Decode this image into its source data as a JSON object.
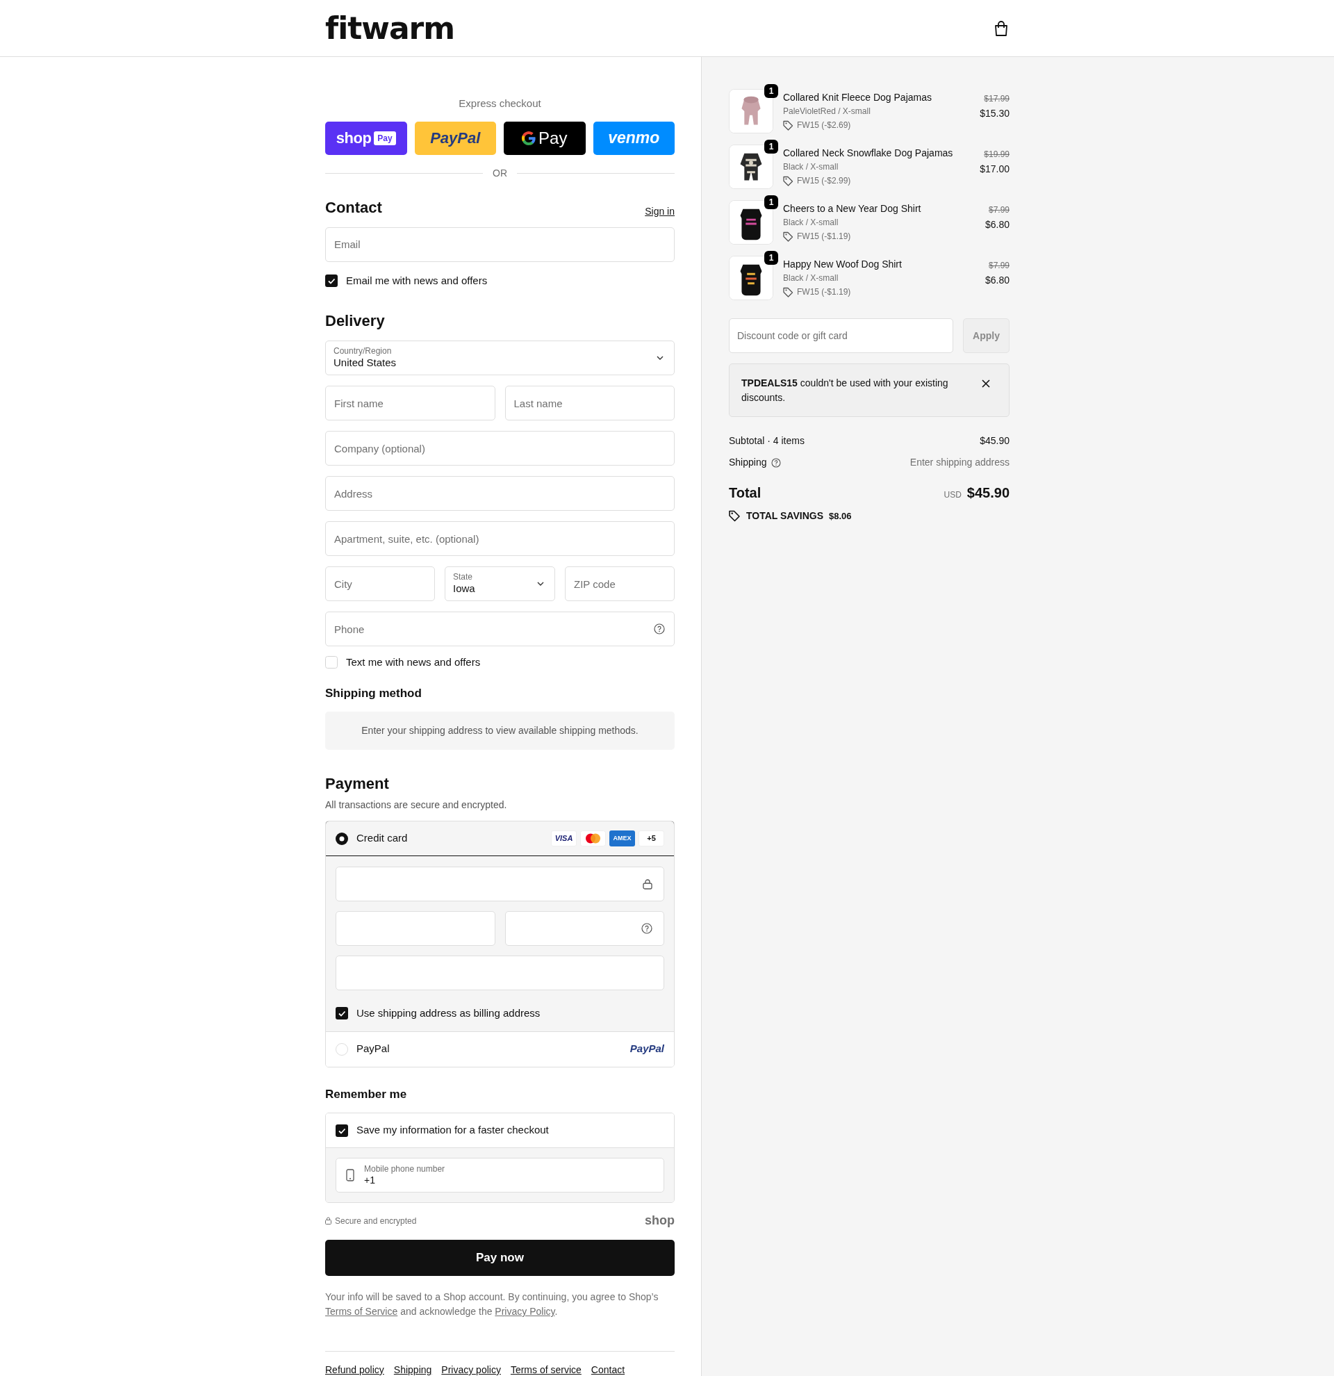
{
  "header": {
    "logo": "fitwarm"
  },
  "express": {
    "title": "Express checkout",
    "buttons": [
      {
        "kind": "shop_pay",
        "label": "shop",
        "badge": "Pay"
      },
      {
        "kind": "paypal",
        "label": "PayPal"
      },
      {
        "kind": "gpay",
        "label": "Pay"
      },
      {
        "kind": "venmo",
        "label": "venmo"
      }
    ],
    "divider": "OR"
  },
  "contact": {
    "title": "Contact",
    "link": "Sign in",
    "email": {
      "placeholder": "Email"
    },
    "newsletter": {
      "label": "Email me with news and offers",
      "checked": true
    }
  },
  "delivery": {
    "title": "Delivery",
    "rows": [
      [
        {
          "kind": "select",
          "label": "Country/Region",
          "value": "United States"
        }
      ],
      [
        {
          "kind": "text",
          "placeholder": "First name"
        },
        {
          "kind": "text",
          "placeholder": "Last name"
        }
      ],
      [
        {
          "kind": "text",
          "placeholder": "Company (optional)"
        }
      ],
      [
        {
          "kind": "text",
          "placeholder": "Address"
        }
      ],
      [
        {
          "kind": "text",
          "placeholder": "Apartment, suite, etc. (optional)"
        }
      ],
      [
        {
          "kind": "text",
          "placeholder": "City"
        },
        {
          "kind": "select",
          "label": "State",
          "value": "Iowa"
        },
        {
          "kind": "text",
          "placeholder": "ZIP code"
        }
      ],
      [
        {
          "kind": "help",
          "placeholder": "Phone"
        }
      ]
    ],
    "sms": {
      "label": "Text me with news and offers",
      "checked": false
    }
  },
  "shipping_method": {
    "title": "Shipping method",
    "notice": "Enter your shipping address to view available shipping methods."
  },
  "payment": {
    "title": "Payment",
    "subtitle": "All transactions are secure and encrypted.",
    "methods": [
      {
        "kind": "card",
        "label": "Credit card",
        "selected": true,
        "brands": [
          {
            "kind": "visa",
            "label": "VISA"
          },
          {
            "kind": "mastercard"
          },
          {
            "kind": "amex",
            "label": "AMEX"
          },
          {
            "kind": "more",
            "label": "+5"
          }
        ],
        "billing": {
          "label": "Use shipping address as billing address",
          "checked": true
        }
      },
      {
        "kind": "paypal",
        "label": "PayPal",
        "selected": false,
        "logo": "PayPal"
      }
    ]
  },
  "remember": {
    "title": "Remember me",
    "save": {
      "label": "Save my information for a faster checkout",
      "checked": true
    },
    "phone": {
      "label": "Mobile phone number",
      "value": "+1"
    }
  },
  "secure": {
    "label": "Secure and encrypted",
    "logo": "shop"
  },
  "pay_button": "Pay now",
  "legal": [
    {
      "kind": "text",
      "text": "Your info will be saved to a Shop account. By continuing, you agree to Shop’s "
    },
    {
      "kind": "link",
      "text": "Terms of Service"
    },
    {
      "kind": "text",
      "text": " and acknowledge the "
    },
    {
      "kind": "link",
      "text": "Privacy Policy"
    },
    {
      "kind": "text",
      "text": "."
    }
  ],
  "footer_links": [
    "Refund policy",
    "Shipping",
    "Privacy policy",
    "Terms of service",
    "Contact"
  ],
  "summary": {
    "items": [
      {
        "name": "Collared Knit Fleece Dog Pajamas",
        "variant": "PaleVioletRed / X-small",
        "discount": "FW15 (-$2.69)",
        "original_price": "$17.99",
        "price": "$15.30",
        "quantity": "1"
      },
      {
        "name": "Collared Neck Snowflake Dog Pajamas",
        "variant": "Black / X-small",
        "discount": "FW15 (-$2.99)",
        "original_price": "$19.99",
        "price": "$17.00",
        "quantity": "1"
      },
      {
        "name": "Cheers to a New Year Dog Shirt",
        "variant": "Black / X-small",
        "discount": "FW15 (-$1.19)",
        "original_price": "$7.99",
        "price": "$6.80",
        "quantity": "1"
      },
      {
        "name": "Happy New Woof Dog Shirt",
        "variant": "Black / X-small",
        "discount": "FW15 (-$1.19)",
        "original_price": "$7.99",
        "price": "$6.80",
        "quantity": "1"
      }
    ],
    "discount": {
      "placeholder": "Discount code or gift card",
      "button": "Apply"
    },
    "message": "**TPDEALS15** couldn't be used with your existing discounts.",
    "subtotal": {
      "label": "Subtotal · 4 items",
      "value": "$45.90"
    },
    "shipping": {
      "label": "Shipping",
      "value": "Enter shipping address"
    },
    "total": {
      "label": "Total",
      "currency": "USD",
      "value": "$45.90"
    },
    "savings": {
      "label": "TOTAL SAVINGS",
      "value": "$8.06"
    }
  }
}
